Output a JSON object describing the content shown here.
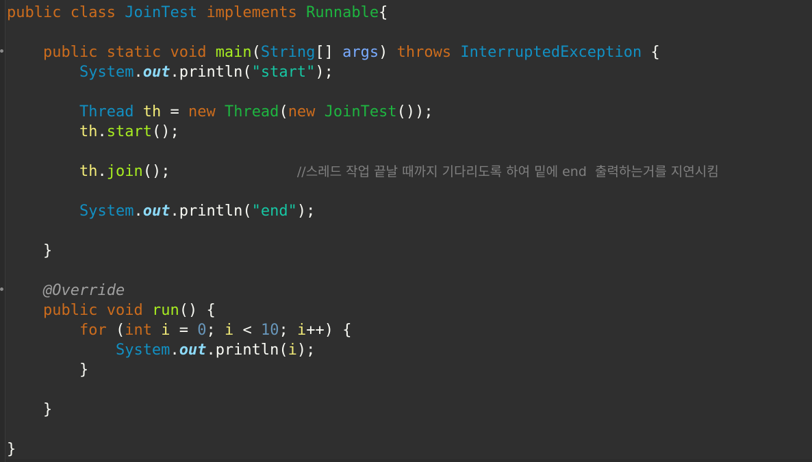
{
  "editor": {
    "lines": [
      [
        "public",
        "class",
        "JoinTest",
        "implements",
        "Runnable",
        "{"
      ],
      [],
      [
        "public",
        "static",
        "void",
        "main",
        "(",
        "String",
        "[]",
        "args",
        ")",
        "throws",
        "InterruptedException",
        "{"
      ],
      [
        "System",
        ".",
        "out",
        ".",
        "println",
        "(",
        "\"start\"",
        ");"
      ],
      [],
      [
        "Thread",
        "th",
        "=",
        "new",
        "Thread",
        "(",
        "new",
        "JoinTest",
        "());"
      ],
      [
        "th",
        ".",
        "start",
        "();"
      ],
      [],
      [
        "th",
        ".",
        "join",
        "();",
        "//스레드 작업 끝날 때까지 기다리도록 하여 밑에 end  출력하는거를 지연시킴"
      ],
      [],
      [
        "System",
        ".",
        "out",
        ".",
        "println",
        "(",
        "\"end\"",
        ");"
      ],
      [],
      [
        "}"
      ],
      [],
      [
        "@Override"
      ],
      [
        "public",
        "void",
        "run",
        "()",
        "{"
      ],
      [
        "for",
        "(",
        "int",
        "i",
        "=",
        "0",
        ";",
        "i",
        "<",
        "10",
        ";",
        "i",
        "++)",
        "{"
      ],
      [
        "System",
        ".",
        "out",
        ".",
        "println",
        "(",
        "i",
        ");"
      ],
      [
        "}"
      ],
      [],
      [
        "}"
      ],
      [],
      [
        "}"
      ]
    ]
  }
}
